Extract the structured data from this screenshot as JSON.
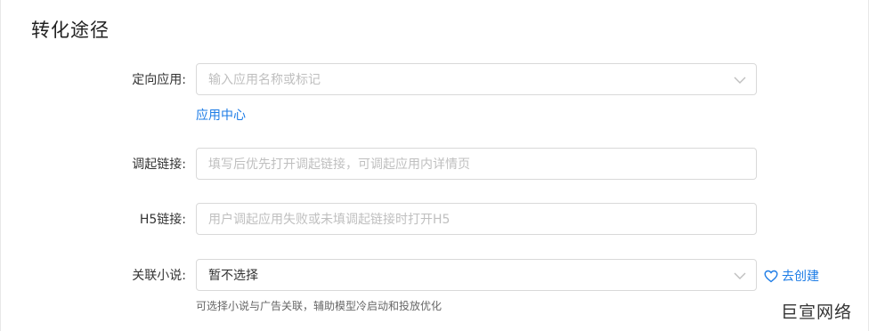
{
  "section": {
    "title": "转化途径"
  },
  "fields": {
    "target_app": {
      "label": "定向应用:",
      "placeholder": "输入应用名称或标记",
      "link": "应用中心"
    },
    "deeplink": {
      "label": "调起链接:",
      "placeholder": "填写后优先打开调起链接，可调起应用内详情页"
    },
    "h5_link": {
      "label": "H5链接:",
      "placeholder": "用户调起应用失败或未填调起链接时打开H5"
    },
    "novel": {
      "label": "关联小说:",
      "value": "暂不选择",
      "create_link": "去创建",
      "hint": "可选择小说与广告关联，辅助模型冷启动和投放优化"
    }
  },
  "watermark": "巨宣网络",
  "icons": {
    "dropdown": "chevron-down-icon",
    "create": "heart-outline-icon"
  },
  "colors": {
    "link": "#1d7ce6",
    "border": "#d9d9d9",
    "placeholder": "#bfbfbf"
  }
}
